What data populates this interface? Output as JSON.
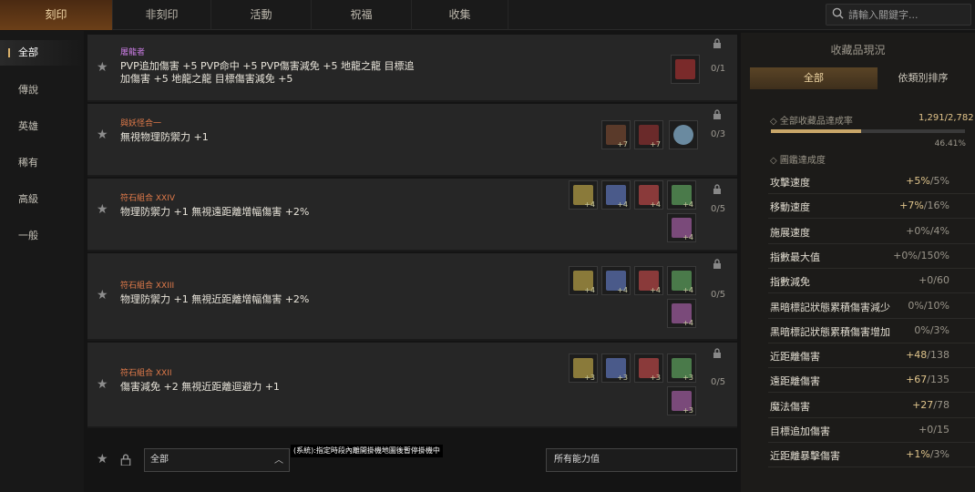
{
  "top_tabs": [
    {
      "label": "刻印",
      "active": true
    },
    {
      "label": "非刻印",
      "active": false
    },
    {
      "label": "活動",
      "active": false
    },
    {
      "label": "祝福",
      "active": false
    },
    {
      "label": "收集",
      "active": false
    }
  ],
  "search": {
    "placeholder": "請輸入關鍵字..."
  },
  "sidebar": {
    "items": [
      {
        "label": "全部",
        "active": true
      },
      {
        "label": "傳說",
        "active": false
      },
      {
        "label": "英雄",
        "active": false
      },
      {
        "label": "稀有",
        "active": false
      },
      {
        "label": "高級",
        "active": false
      },
      {
        "label": "一般",
        "active": false
      }
    ]
  },
  "rows": [
    {
      "title": "屠龍者",
      "title_color": "#c77be0",
      "desc_lines": [
        "PVP追加傷害 +5 PVP命中 +5 PVP傷害減免 +5 地龍之龍 目標追",
        "加傷害 +5 地龍之龍 目標傷害減免 +5"
      ],
      "count": "0/1",
      "items": [
        {
          "icon": "dagger-icon",
          "color": "#7a2a2a",
          "level": ""
        }
      ]
    },
    {
      "title": "與妖怪合一",
      "title_color": "#e07a4a",
      "desc_lines": [
        "無視物理防禦力 +1"
      ],
      "count": "0/3",
      "items": [
        {
          "icon": "spear-icon",
          "color": "#5a3a2a",
          "level": "+7"
        },
        {
          "icon": "bow-icon",
          "color": "#6a2a2a",
          "level": "+7"
        },
        {
          "icon": "orb-icon",
          "color": "#6a8aa0",
          "level": ""
        }
      ]
    },
    {
      "title": "符石組合 XXIV",
      "title_color": "#e07a4a",
      "desc_lines": [
        "物理防禦力 +1 無視遠距離增幅傷害 +2%"
      ],
      "count": "0/5",
      "items": [
        {
          "icon": "runestone-icon",
          "color": "#8a7a3a",
          "level": "+4"
        },
        {
          "icon": "runestone-icon",
          "color": "#4a5a8a",
          "level": "+4"
        },
        {
          "icon": "runestone-icon",
          "color": "#8a3a3a",
          "level": "+4"
        },
        {
          "icon": "runestone-icon",
          "color": "#4a7a4a",
          "level": "+4"
        },
        {
          "icon": "runestone-icon",
          "color": "#7a4a7a",
          "level": "+4"
        }
      ]
    },
    {
      "title": "符石組合 XXIII",
      "title_color": "#e07a4a",
      "desc_lines": [
        "物理防禦力 +1 無視近距離增幅傷害 +2%"
      ],
      "count": "0/5",
      "items": [
        {
          "icon": "runestone-icon",
          "color": "#8a7a3a",
          "level": "+4"
        },
        {
          "icon": "runestone-icon",
          "color": "#4a5a8a",
          "level": "+4"
        },
        {
          "icon": "runestone-icon",
          "color": "#8a3a3a",
          "level": "+4"
        },
        {
          "icon": "runestone-icon",
          "color": "#4a7a4a",
          "level": "+4"
        },
        {
          "icon": "runestone-icon",
          "color": "#7a4a7a",
          "level": "+4"
        }
      ]
    },
    {
      "title": "符石組合 XXII",
      "title_color": "#e07a4a",
      "desc_lines": [
        "傷害減免 +2 無視近距離迴避力 +1"
      ],
      "count": "0/5",
      "items": [
        {
          "icon": "runestone-icon",
          "color": "#8a7a3a",
          "level": "+3"
        },
        {
          "icon": "runestone-icon",
          "color": "#4a5a8a",
          "level": "+3"
        },
        {
          "icon": "runestone-icon",
          "color": "#8a3a3a",
          "level": "+3"
        },
        {
          "icon": "runestone-icon",
          "color": "#4a7a4a",
          "level": "+3"
        },
        {
          "icon": "runestone-icon",
          "color": "#7a4a7a",
          "level": "+3"
        }
      ]
    }
  ],
  "bottom": {
    "filter_all": "全部",
    "ability_filter": "所有能力值",
    "tooltip": "(系統):指定時段內離開掛機地圖後暫停掛機中"
  },
  "right_panel": {
    "title": "收藏品現況",
    "tabs": [
      {
        "label": "全部",
        "active": true
      },
      {
        "label": "依類別排序",
        "active": false
      }
    ],
    "overall_label": "◇ 全部收藏品達成率",
    "overall_count": "1,291/2,782",
    "overall_fraction": 0.4641,
    "overall_pct": "46.41%",
    "book_label": "◇ 圖鑑達成度",
    "stats": [
      {
        "name": "攻擊速度",
        "cur": "+5%",
        "max": "/5%",
        "zero": false
      },
      {
        "name": "移動速度",
        "cur": "+7%",
        "max": "/16%",
        "zero": false
      },
      {
        "name": "施展速度",
        "cur": "+0%",
        "max": "/4%",
        "zero": true
      },
      {
        "name": "指數最大值",
        "cur": "+0%",
        "max": "/150%",
        "zero": true
      },
      {
        "name": "指數減免",
        "cur": "+0",
        "max": "/60",
        "zero": true
      },
      {
        "name": "黑暗標記狀態累積傷害減少",
        "cur": "0%",
        "max": "/10%",
        "zero": true
      },
      {
        "name": "黑暗標記狀態累積傷害增加",
        "cur": "0%",
        "max": "/3%",
        "zero": true
      },
      {
        "name": "近距離傷害",
        "cur": "+48",
        "max": "/138",
        "zero": false
      },
      {
        "name": "遠距離傷害",
        "cur": "+67",
        "max": "/135",
        "zero": false
      },
      {
        "name": "魔法傷害",
        "cur": "+27",
        "max": "/78",
        "zero": false
      },
      {
        "name": "目標追加傷害",
        "cur": "+0",
        "max": "/15",
        "zero": true
      },
      {
        "name": "近距離暴擊傷害",
        "cur": "+1%",
        "max": "/3%",
        "zero": false
      }
    ]
  },
  "colors": {
    "accent": "#d8b06a",
    "tab_active": "#6b3f18",
    "value_gold": "#e0c58c"
  }
}
